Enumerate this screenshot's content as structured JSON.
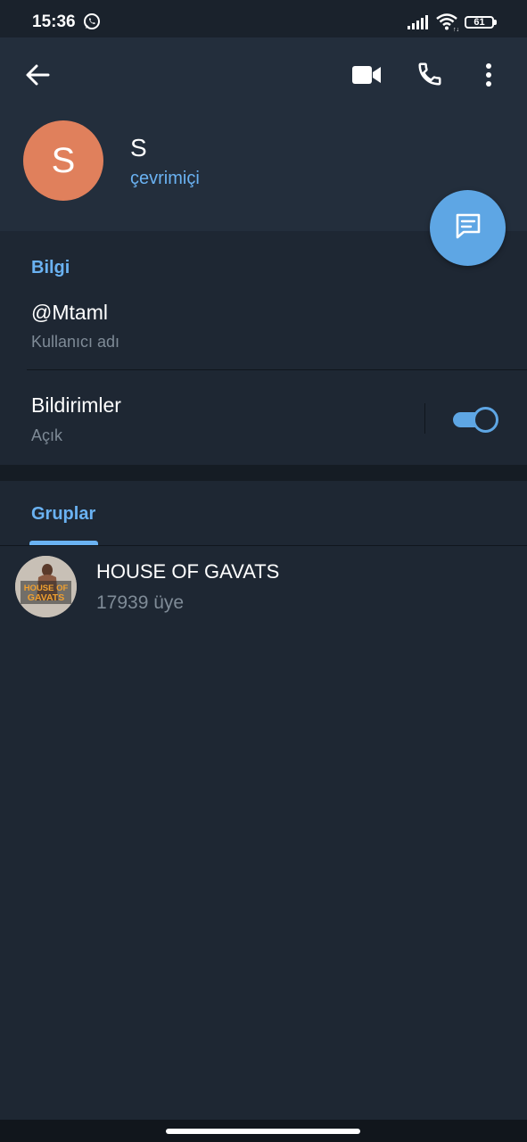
{
  "status_bar": {
    "time": "15:36",
    "battery": "61",
    "icons": [
      "whatsapp-icon",
      "signal-icon",
      "wifi-icon",
      "battery-icon"
    ]
  },
  "header": {
    "icons": [
      "back-arrow-icon",
      "video-call-icon",
      "phone-icon",
      "more-vert-icon"
    ],
    "avatar_letter": "S",
    "name": "S",
    "status": "çevrimiçi",
    "accent_color": "#6ab2f2",
    "avatar_color": "#e0805c"
  },
  "fab": {
    "icon": "message-icon",
    "color": "#5ea6e4"
  },
  "info": {
    "title": "Bilgi",
    "username": "@Mtaml",
    "username_label": "Kullanıcı adı",
    "notifications": "Bildirimler",
    "notifications_state": "Açık",
    "notifications_on": true
  },
  "groups": {
    "tab": "Gruplar",
    "items": [
      {
        "name": "HOUSE OF GAVATS",
        "members": "17939 üye",
        "avatar_text": "HOUSE OF GAVATS"
      }
    ]
  }
}
